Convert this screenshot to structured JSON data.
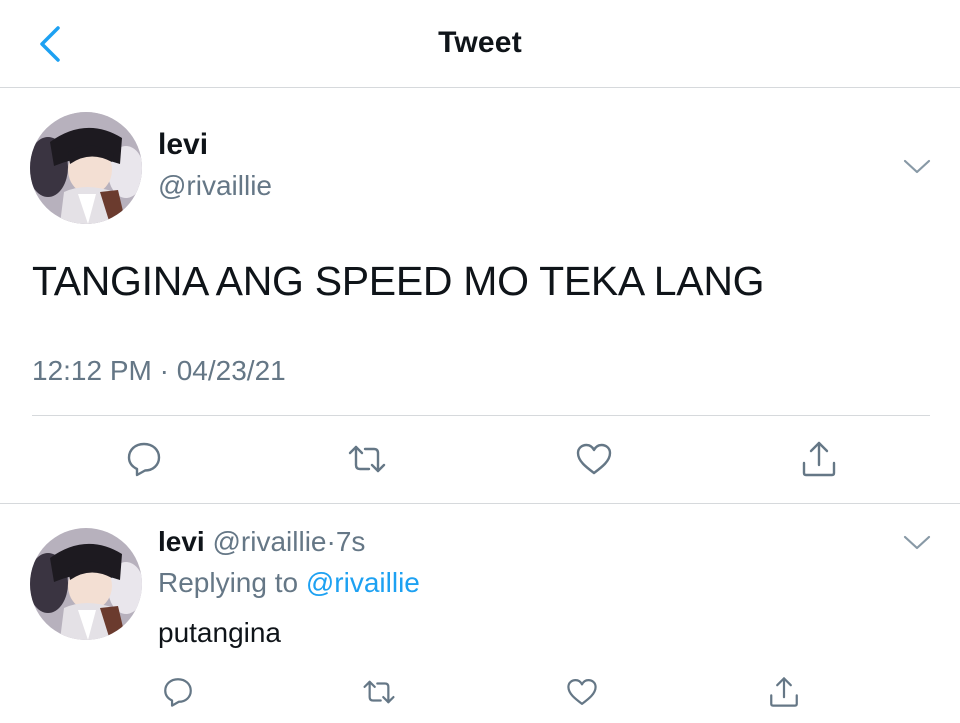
{
  "header": {
    "title": "Tweet"
  },
  "tweet": {
    "name": "levi",
    "handle": "@rivaillie",
    "text": "TANGINA ANG SPEED MO TEKA LANG",
    "timestamp": "12:12 PM · 04/23/21"
  },
  "reply": {
    "name": "levi",
    "handle": "@rivaillie",
    "separator": "·",
    "time": "7s",
    "replying_prefix": "Replying to",
    "replying_handle": "@rivaillie",
    "text": "putangina"
  },
  "icons": {
    "back": "chevron-left-icon",
    "caret": "chevron-down-icon",
    "reply": "reply-icon",
    "retweet": "retweet-icon",
    "like": "heart-icon",
    "share": "share-icon"
  },
  "colors": {
    "accent": "#1da1f2",
    "text": "#0f1419",
    "secondary": "#657786",
    "divider": "#d6d9dc"
  }
}
